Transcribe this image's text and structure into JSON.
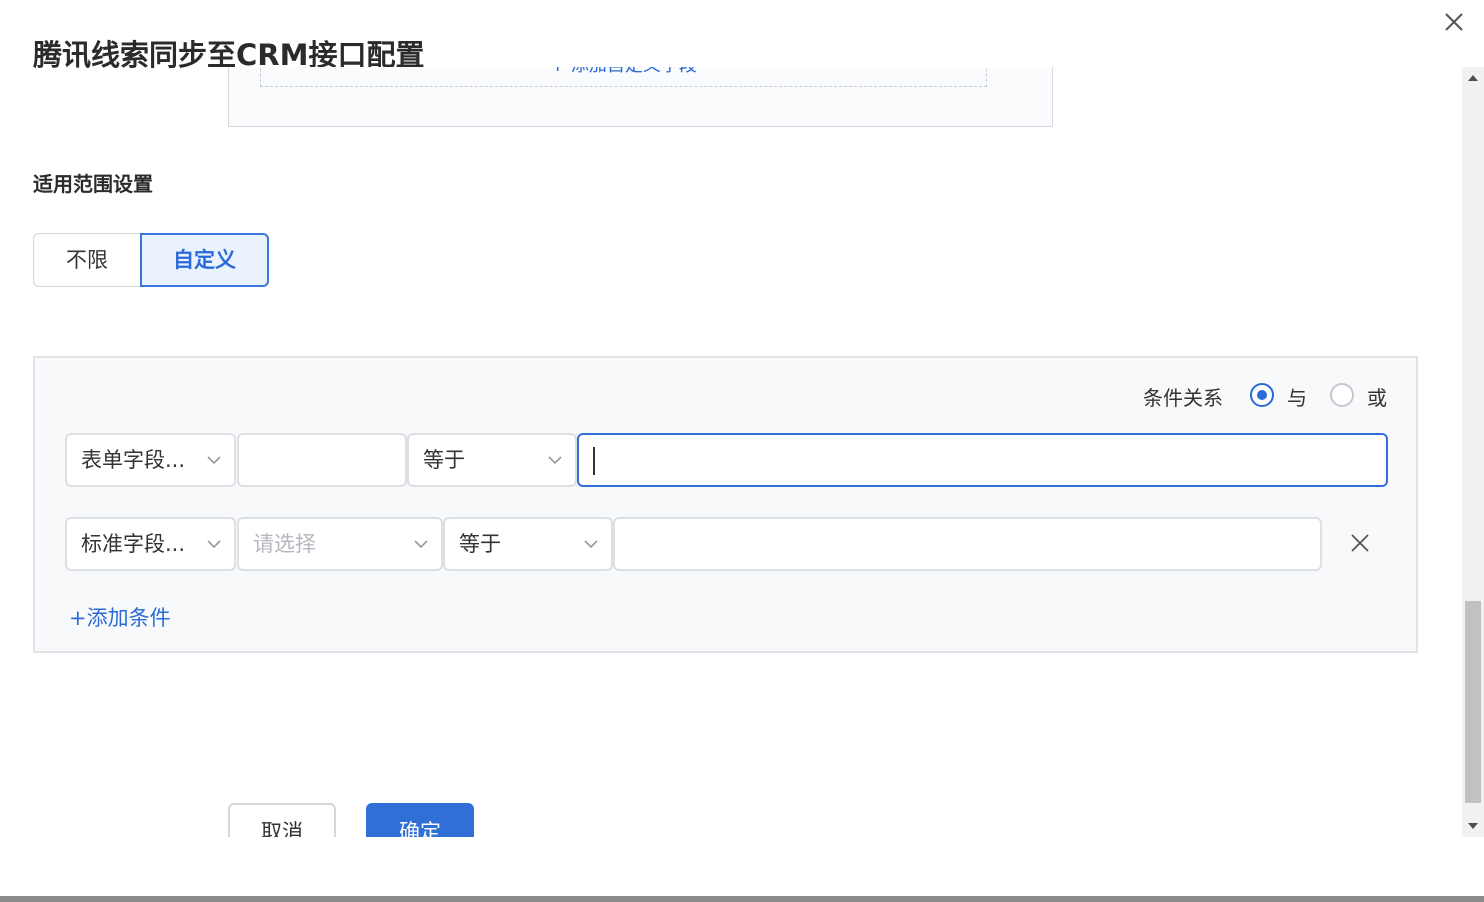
{
  "dialog": {
    "title": "腾讯线索同步至CRM接口配置"
  },
  "fields": {
    "add_custom_field": "+ 添加自定义字段"
  },
  "scope": {
    "section_title": "适用范围设置",
    "options": [
      "不限",
      "自定义"
    ],
    "selected": "自定义"
  },
  "conditions": {
    "relation_label": "条件关系",
    "relation_options": [
      "与",
      "或"
    ],
    "relation_selected": "与",
    "rows": [
      {
        "field_type": "表单字段...",
        "field": "",
        "field_placeholder": "",
        "operator": "等于",
        "value": ""
      },
      {
        "field_type": "标准字段...",
        "field": "",
        "field_placeholder": "请选择",
        "operator": "等于",
        "value": ""
      }
    ],
    "add_condition": "+添加条件"
  },
  "footer": {
    "cancel": "取消",
    "ok": "确定"
  },
  "colors": {
    "accent": "#2a6ad9",
    "border": "#dcdfe4",
    "panel_bg": "#f8f9fb"
  },
  "icons": {
    "close": "close-icon",
    "chevron": "chevron-down-icon",
    "delete": "close-icon"
  }
}
